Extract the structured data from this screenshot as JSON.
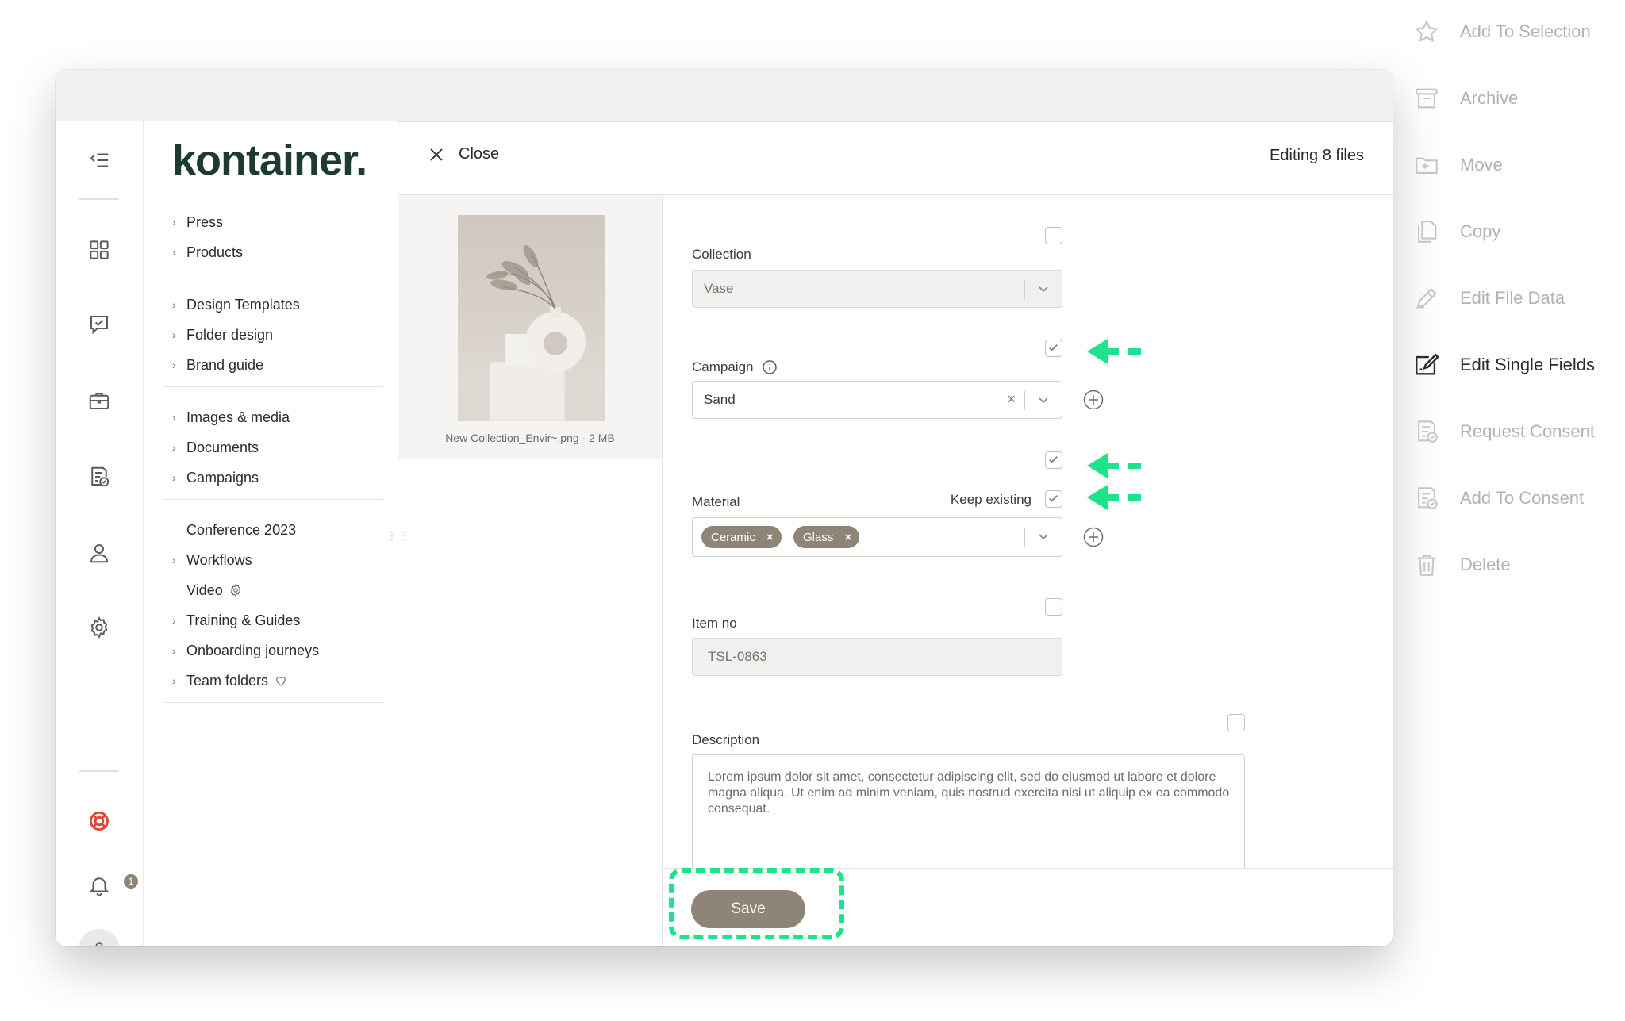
{
  "brand": {
    "logo_text": "kontainer."
  },
  "rail": {
    "items": [
      "collapse-icon",
      "dashboard-icon",
      "approval-icon",
      "briefcase-icon",
      "consent-icon",
      "user-icon",
      "gear-icon",
      "help-lifebuoy-icon",
      "bell-icon"
    ],
    "notification_count": "1"
  },
  "nav": {
    "groups": [
      [
        {
          "label": "Press",
          "chevron": true
        },
        {
          "label": "Products",
          "chevron": true
        }
      ],
      [
        {
          "label": "Design Templates",
          "chevron": true
        },
        {
          "label": "Folder design",
          "chevron": true
        },
        {
          "label": "Brand guide",
          "chevron": true
        }
      ],
      [
        {
          "label": "Images & media",
          "chevron": true
        },
        {
          "label": "Documents",
          "chevron": true
        },
        {
          "label": "Campaigns",
          "chevron": true
        }
      ],
      [
        {
          "label": "Conference 2023",
          "chevron": false
        },
        {
          "label": "Workflows",
          "chevron": true
        },
        {
          "label": "Video",
          "chevron": false,
          "trail": "gear-icon"
        },
        {
          "label": "Training & Guides",
          "chevron": true
        },
        {
          "label": "Onboarding journeys",
          "chevron": true
        },
        {
          "label": "Team folders",
          "chevron": true,
          "trail": "heart-icon"
        }
      ]
    ]
  },
  "header": {
    "close_label": "Close",
    "editing_label": "Editing 8 files"
  },
  "preview": {
    "file_label": "New Collection_Envir~.png · 2 MB"
  },
  "form": {
    "collection": {
      "label": "Collection",
      "value": "Vase"
    },
    "campaign": {
      "label": "Campaign",
      "value": "Sand"
    },
    "material": {
      "label": "Material",
      "keep_existing_label": "Keep existing",
      "chips": [
        "Ceramic",
        "Glass"
      ]
    },
    "item_no": {
      "label": "Item no",
      "value": "TSL-0863"
    },
    "description": {
      "label": "Description",
      "value": "Lorem ipsum dolor sit amet, consectetur adipiscing elit, sed do eiusmod ut labore et dolore magna aliqua. Ut enim ad minim veniam, quis nostrud exercita nisi ut aliquip ex ea commodo consequat."
    },
    "save_label": "Save"
  },
  "actions": [
    {
      "label": "Add To Selection",
      "icon": "star-icon",
      "active": false
    },
    {
      "label": "Archive",
      "icon": "archive-icon",
      "active": false
    },
    {
      "label": "Move",
      "icon": "move-folder-icon",
      "active": false
    },
    {
      "label": "Copy",
      "icon": "copy-icon",
      "active": false
    },
    {
      "label": "Edit File Data",
      "icon": "edit-file-data-icon",
      "active": false
    },
    {
      "label": "Edit Single Fields",
      "icon": "edit-single-fields-icon",
      "active": true
    },
    {
      "label": "Request Consent",
      "icon": "request-consent-icon",
      "active": false
    },
    {
      "label": "Add To Consent",
      "icon": "add-consent-icon",
      "active": false
    },
    {
      "label": "Delete",
      "icon": "trash-icon",
      "active": false
    }
  ],
  "colors": {
    "accent": "#8f8577",
    "brand": "#1e3a34",
    "highlight": "#1ee38c"
  }
}
